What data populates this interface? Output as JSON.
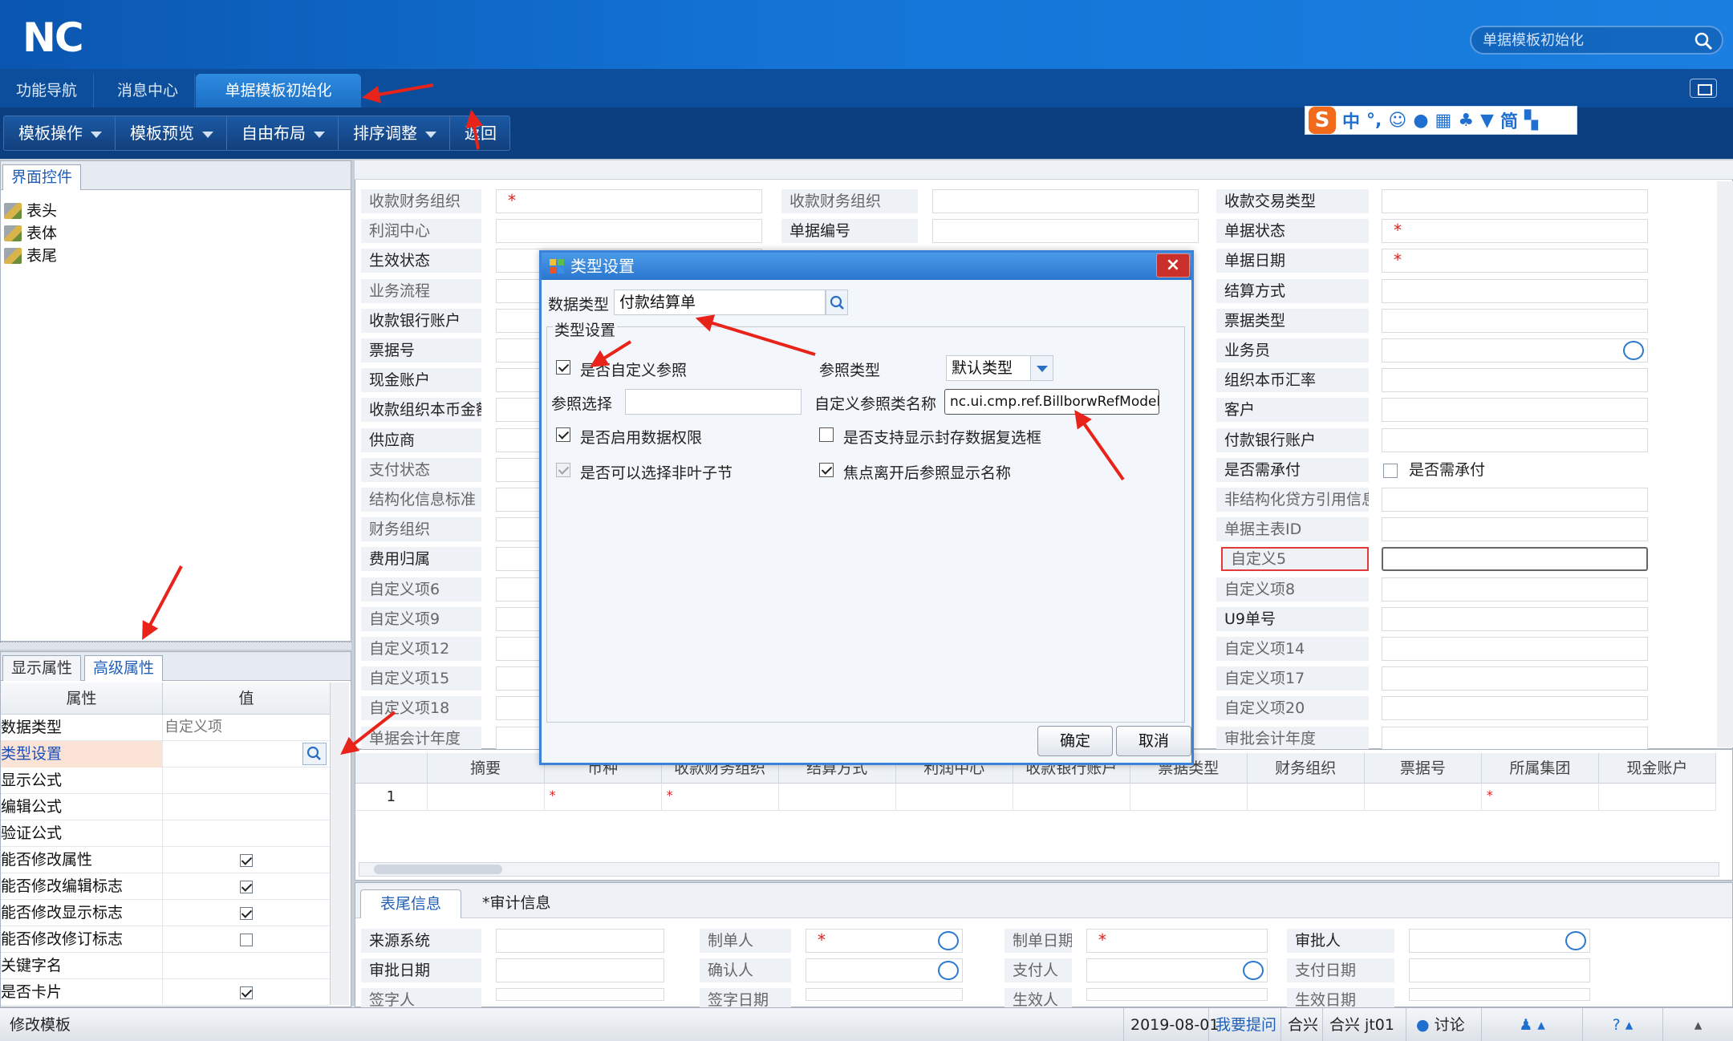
{
  "app": {
    "logo": "NC"
  },
  "search": {
    "placeholder": "单据模板初始化"
  },
  "tabs": [
    {
      "label": "功能导航"
    },
    {
      "label": "消息中心"
    },
    {
      "label": "单据模板初始化"
    }
  ],
  "toolbar": {
    "items": [
      {
        "label": "模板操作"
      },
      {
        "label": "模板预览"
      },
      {
        "label": "自由布局"
      },
      {
        "label": "排序调整"
      },
      {
        "label": "返回"
      }
    ]
  },
  "ime": {
    "brand": "S",
    "lang": "中",
    "mode": "简"
  },
  "left_panel": {
    "tab_label": "界面控件",
    "tree": [
      {
        "label": "表头"
      },
      {
        "label": "表体"
      },
      {
        "label": "表尾"
      }
    ],
    "prop_tabs": [
      {
        "label": "显示属性"
      },
      {
        "label": "高级属性"
      }
    ],
    "grid_headers": {
      "attr": "属性",
      "value": "值"
    },
    "rows": [
      {
        "key": "数据类型",
        "value": "自定义项"
      },
      {
        "key": "类型设置",
        "value": ""
      },
      {
        "key": "显示公式",
        "value": ""
      },
      {
        "key": "编辑公式",
        "value": ""
      },
      {
        "key": "验证公式",
        "value": ""
      },
      {
        "key": "能否修改属性",
        "checked": true
      },
      {
        "key": "能否修改编辑标志",
        "checked": true
      },
      {
        "key": "能否修改显示标志",
        "checked": true
      },
      {
        "key": "能否修改修订标志",
        "checked": false
      },
      {
        "key": "关键字名",
        "value": ""
      },
      {
        "key": "是否卡片",
        "checked": true
      }
    ]
  },
  "form": {
    "col1": [
      "收款财务组织",
      "利润中心",
      "生效状态",
      "业务流程",
      "收款银行账户",
      "票据号",
      "现金账户",
      "收款组织本币金额",
      "供应商",
      "支付状态",
      "结构化信息标准",
      "财务组织",
      "费用归属",
      "自定义项6",
      "自定义项9",
      "自定义项12",
      "自定义项15",
      "自定义项18",
      "单据会计年度"
    ],
    "col2": [
      "收款财务组织",
      "单据编号"
    ],
    "col3": [
      "收款交易类型",
      "单据状态",
      "单据日期",
      "结算方式",
      "票据类型",
      "业务员",
      "组织本币汇率",
      "客户",
      "付款银行账户",
      "是否需承付",
      "非结构化贷方引用信息",
      "单据主表ID",
      "自定义5",
      "自定义项8",
      "U9单号",
      "自定义项14",
      "自定义项17",
      "自定义项20",
      "审批会计年度"
    ],
    "checkbox_label": "是否需承付",
    "required_mark": "*"
  },
  "table": {
    "headers": [
      "摘要",
      "币种",
      "收款财务组织",
      "结算方式",
      "利润中心",
      "收款银行账户",
      "票据类型",
      "财务组织",
      "票据号",
      "所属集团",
      "现金账户"
    ],
    "row_no": "1"
  },
  "footer": {
    "tabs": [
      {
        "label": "表尾信息"
      },
      {
        "label": "*审计信息"
      }
    ],
    "row1": [
      "来源系统",
      "制单人",
      "制单日期",
      "审批人"
    ],
    "row2": [
      "审批日期",
      "确认人",
      "支付人",
      "支付日期"
    ],
    "row3": [
      "签字人",
      "签字日期",
      "生效人",
      "生效日期"
    ]
  },
  "status": {
    "left": "修改模板",
    "date": "2019-08-01",
    "ask": "我要提问",
    "org": "合兴",
    "user": "合兴  jt01",
    "discuss": "讨论"
  },
  "dialog": {
    "title": "类型设置",
    "close": "×",
    "data_type_label": "数据类型",
    "data_type_value": "付款结算单",
    "group_label": "类型设置",
    "custom_ref_label": "是否自定义参照",
    "custom_ref_checked": true,
    "ref_type_label": "参照类型",
    "ref_type_value": "默认类型",
    "ref_select_label": "参照选择",
    "custom_class_label": "自定义参照类名称",
    "custom_class_value": "nc.ui.cmp.ref.BillborwRefModel",
    "data_perm_label": "是否启用数据权限",
    "data_perm_checked": true,
    "seal_label": "是否支持显示封存数据复选框",
    "seal_checked": false,
    "nonleaf_label": "是否可以选择非叶子节",
    "nonleaf_checked": true,
    "focus_label": "焦点离开后参照显示名称",
    "focus_checked": true,
    "ok": "确定",
    "cancel": "取消"
  },
  "colors": {
    "accent": "#1a7fe0",
    "annotation": "#e8231a",
    "required": "#e02020"
  }
}
